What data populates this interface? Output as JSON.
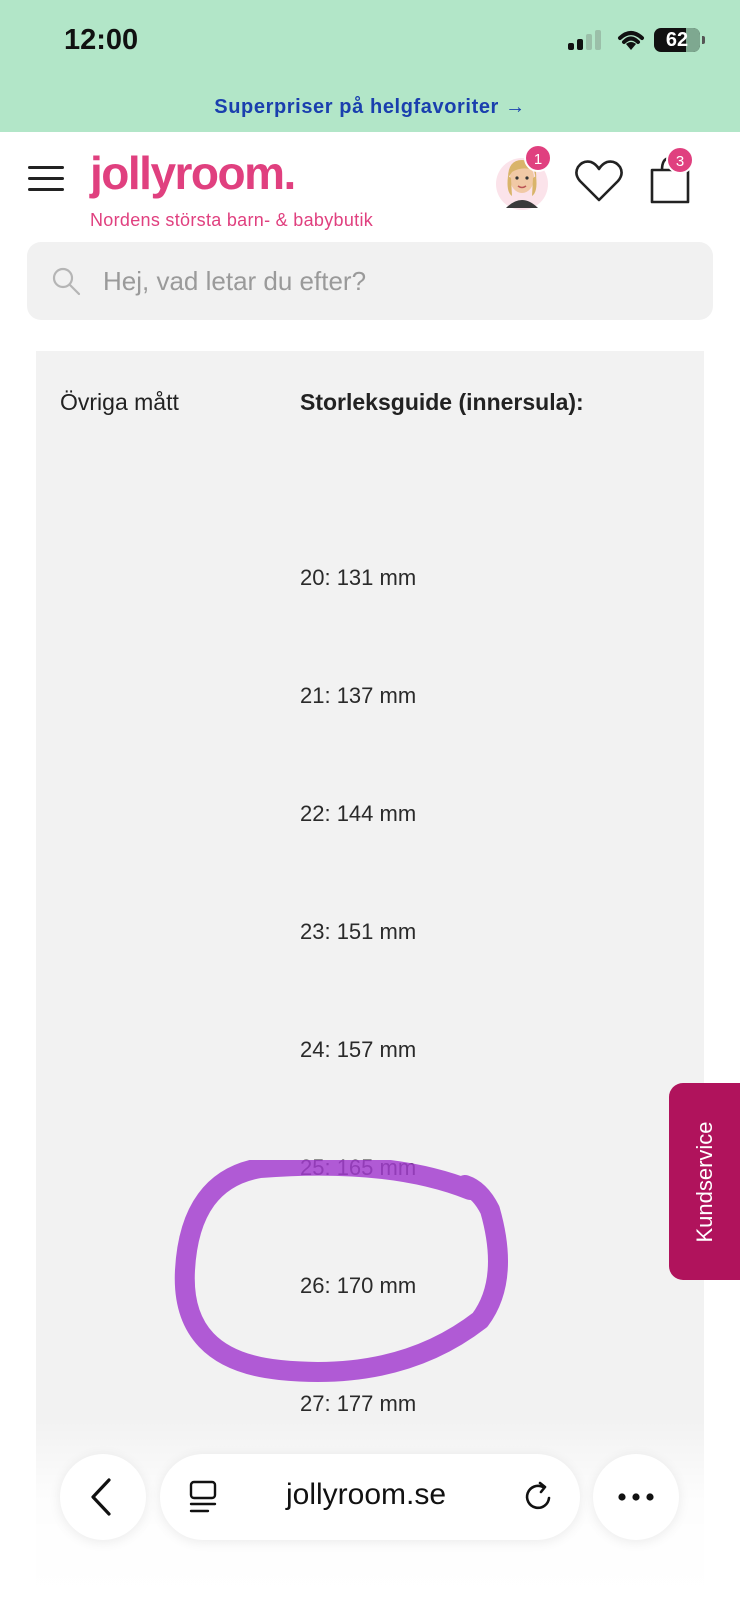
{
  "status_bar": {
    "time": "12:00",
    "battery": "62"
  },
  "promo": {
    "text": "Superpriser på helgfavoriter →"
  },
  "header": {
    "logo": "jollyroom.",
    "tagline": "Nordens största barn- & babybutik",
    "avatar_badge": "1",
    "cart_badge": "3"
  },
  "search": {
    "placeholder": "Hej, vad letar du efter?"
  },
  "content": {
    "left_label": "Övriga mått",
    "right_heading": "Storleksguide (innersula):",
    "sizes": [
      "20: 131 mm",
      "21: 137 mm",
      "22: 144 mm",
      "23: 151 mm",
      "24: 157 mm",
      "25: 165 mm",
      "26: 170 mm",
      "27: 177 mm"
    ]
  },
  "kundservice": {
    "label": "Kundservice"
  },
  "browser": {
    "url": "jollyroom.se"
  },
  "colors": {
    "brand_pink": "#e0407f",
    "promo_bg": "#b2e6c8",
    "promo_text": "#1a3fae",
    "kundservice_bg": "#b0135c",
    "highlight_stroke": "#a53fd0"
  }
}
